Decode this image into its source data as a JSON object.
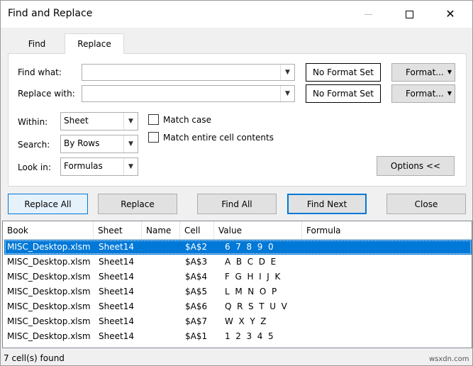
{
  "window": {
    "title": "Find and Replace"
  },
  "tabs": [
    {
      "label": "Find"
    },
    {
      "label": "Replace"
    }
  ],
  "form": {
    "find_label": "Find what:",
    "find_value": "",
    "replace_label": "Replace with:",
    "replace_value": "",
    "no_format_find": "No Format Set",
    "no_format_replace": "No Format Set",
    "format_find": "Format...",
    "format_replace": "Format...",
    "within_label": "Within:",
    "within_value": "Sheet",
    "search_label": "Search:",
    "search_value": "By Rows",
    "lookin_label": "Look in:",
    "lookin_value": "Formulas",
    "match_case": "Match case",
    "match_case_checked": false,
    "match_entire": "Match entire cell contents",
    "match_entire_checked": false,
    "options": "Options <<"
  },
  "actions": {
    "replace_all": "Replace All",
    "replace": "Replace",
    "find_all": "Find All",
    "find_next": "Find Next",
    "close": "Close"
  },
  "results": {
    "columns": [
      "Book",
      "Sheet",
      "Name",
      "Cell",
      "Value",
      "Formula"
    ],
    "rows": [
      {
        "book": "MISC_Desktop.xlsm",
        "sheet": "Sheet14",
        "name": "",
        "cell": "$A$2",
        "value": "6  7  8  9  0",
        "formula": "",
        "selected": true
      },
      {
        "book": "MISC_Desktop.xlsm",
        "sheet": "Sheet14",
        "name": "",
        "cell": "$A$3",
        "value": "A  B  C  D  E",
        "formula": ""
      },
      {
        "book": "MISC_Desktop.xlsm",
        "sheet": "Sheet14",
        "name": "",
        "cell": "$A$4",
        "value": "F  G  H  I  J  K",
        "formula": ""
      },
      {
        "book": "MISC_Desktop.xlsm",
        "sheet": "Sheet14",
        "name": "",
        "cell": "$A$5",
        "value": "L  M  N  O  P",
        "formula": ""
      },
      {
        "book": "MISC_Desktop.xlsm",
        "sheet": "Sheet14",
        "name": "",
        "cell": "$A$6",
        "value": "Q  R  S  T  U  V",
        "formula": ""
      },
      {
        "book": "MISC_Desktop.xlsm",
        "sheet": "Sheet14",
        "name": "",
        "cell": "$A$7",
        "value": "W  X  Y  Z",
        "formula": ""
      },
      {
        "book": "MISC_Desktop.xlsm",
        "sheet": "Sheet14",
        "name": "",
        "cell": "$A$1",
        "value": "1  2  3  4  5",
        "formula": ""
      }
    ]
  },
  "status": "7 cell(s) found",
  "watermark": "wsxdn.com",
  "colors": {
    "selection": "#0078d7",
    "dialog_bg": "#f0f0f0",
    "button_bg": "#e1e1e1"
  }
}
